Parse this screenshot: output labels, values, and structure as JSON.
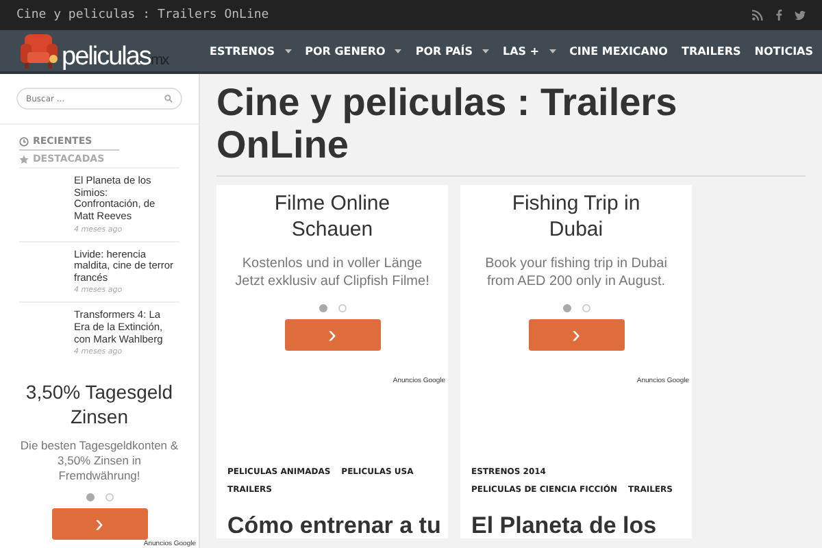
{
  "top_bar": {
    "title": "Cine y peliculas : Trailers OnLine"
  },
  "logo": {
    "text": "peliculas",
    "suffix": "mx"
  },
  "nav": [
    {
      "label": "ESTRENOS",
      "has_submenu": true
    },
    {
      "label": "POR GENERO",
      "has_submenu": true
    },
    {
      "label": "POR PAÍS",
      "has_submenu": true
    },
    {
      "label": "LAS +",
      "has_submenu": true
    },
    {
      "label": "CINE MEXICANO",
      "has_submenu": false
    },
    {
      "label": "TRAILERS",
      "has_submenu": false
    },
    {
      "label": "NOTICIAS",
      "has_submenu": false
    }
  ],
  "sidebar": {
    "search": {
      "placeholder": "Buscar ..."
    },
    "tabs": [
      {
        "label": "RECIENTES",
        "kind": "clock",
        "selected": true
      },
      {
        "label": "DESTACADAS",
        "kind": "star",
        "selected": false
      }
    ],
    "posts": [
      {
        "title": "El Planeta de los Simios: Confrontación, de Matt Reeves",
        "time": "4 meses ago"
      },
      {
        "title": "Livide: herencia maldita, cine de terror francés",
        "time": "4 meses ago"
      },
      {
        "title": "Transformers 4: La Era de la Extinción, con Mark Wahlberg",
        "time": "4 meses ago"
      }
    ],
    "ad": {
      "title": "3,50% Tagesgeld Zinsen",
      "body": "Die besten Tagesgeldkonten & 3,50% Zinsen in Fremdwährung!",
      "dots": [
        {
          "selected": true
        },
        {
          "selected": false
        }
      ],
      "button": "›",
      "attribution": "Anuncios Google"
    }
  },
  "main": {
    "heading": "Cine y peliculas : Trailers OnLine",
    "cards": [
      {
        "ad": {
          "title": "Filme Online Schauen",
          "body": "Kostenlos und in voller Länge Jetzt exklusiv auf Clipfish Filme!",
          "dots": [
            {
              "selected": true
            },
            {
              "selected": false
            }
          ],
          "button": "›",
          "attribution": "Anuncios Google"
        },
        "tags": [
          "PELICULAS ANIMADAS",
          "PELICULAS USA",
          "TRAILERS"
        ],
        "title": "Cómo entrenar a tu"
      },
      {
        "ad": {
          "title": "Fishing Trip in Dubai",
          "body": "Book your fishing trip in Dubai from AED 200 only in August.",
          "dots": [
            {
              "selected": true
            },
            {
              "selected": false
            }
          ],
          "button": "›",
          "attribution": "Anuncios Google"
        },
        "tags": [
          "ESTRENOS 2014",
          "PELICULAS DE CIENCIA FICCIÓN",
          "TRAILERS"
        ],
        "title": "El Planeta de los"
      }
    ]
  }
}
